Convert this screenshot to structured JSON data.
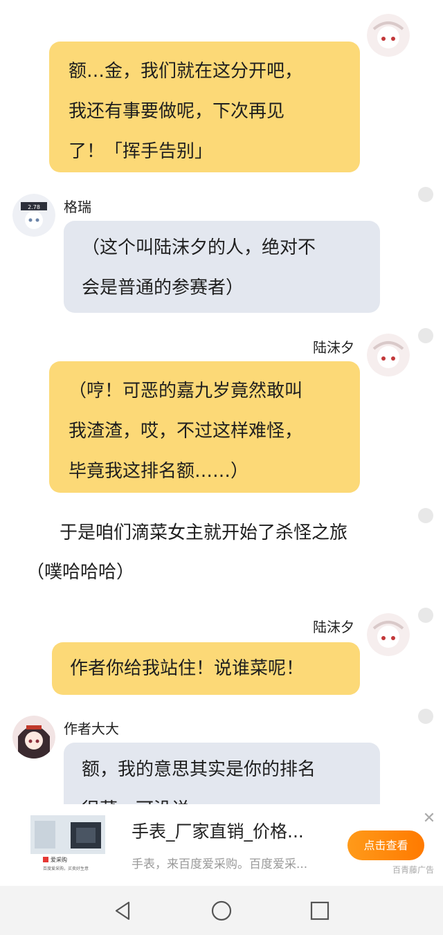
{
  "messages": {
    "m1": {
      "lines": [
        "额…金，我们就在这分开吧，",
        "我还有事要做呢，下次再见",
        "了！「挥手告别」"
      ]
    },
    "m2": {
      "sender": "格瑞",
      "lines": [
        "（这个叫陆沫夕的人，绝对不",
        "会是普通的参赛者）"
      ]
    },
    "m3": {
      "sender": "陆沫夕",
      "lines": [
        "（哼！可恶的嘉九岁竟然敢叫",
        "我渣渣，哎，不过这样难怪，",
        "毕竟我这排名额……）"
      ]
    },
    "narration": {
      "lines": [
        "于是咱们滴菜女主就开始了杀怪之旅",
        "（噗哈哈哈）"
      ]
    },
    "m4": {
      "sender": "陆沫夕",
      "lines": [
        "作者你给我站住！说谁菜呢！"
      ]
    },
    "m5": {
      "sender": "作者大大",
      "lines": [
        "额，我的意思其实是你的排名",
        "很菜，可没说"
      ]
    }
  },
  "ad": {
    "title": "手表_厂家直销_价格...",
    "description": "手表，来百度爱采购。百度爱采...",
    "button": "点击查看",
    "brand": "百青藤广告",
    "thumb_logo": "爱采购",
    "thumb_caption": "百度爱采购，买卖好生意",
    "close": "✕"
  },
  "nav": {
    "back": "back-icon",
    "home": "home-icon",
    "recents": "recents-icon"
  },
  "colors": {
    "right_bubble": "#fcd977",
    "left_bubble": "#e3e7ef",
    "ad_button": "#ff8a00"
  }
}
